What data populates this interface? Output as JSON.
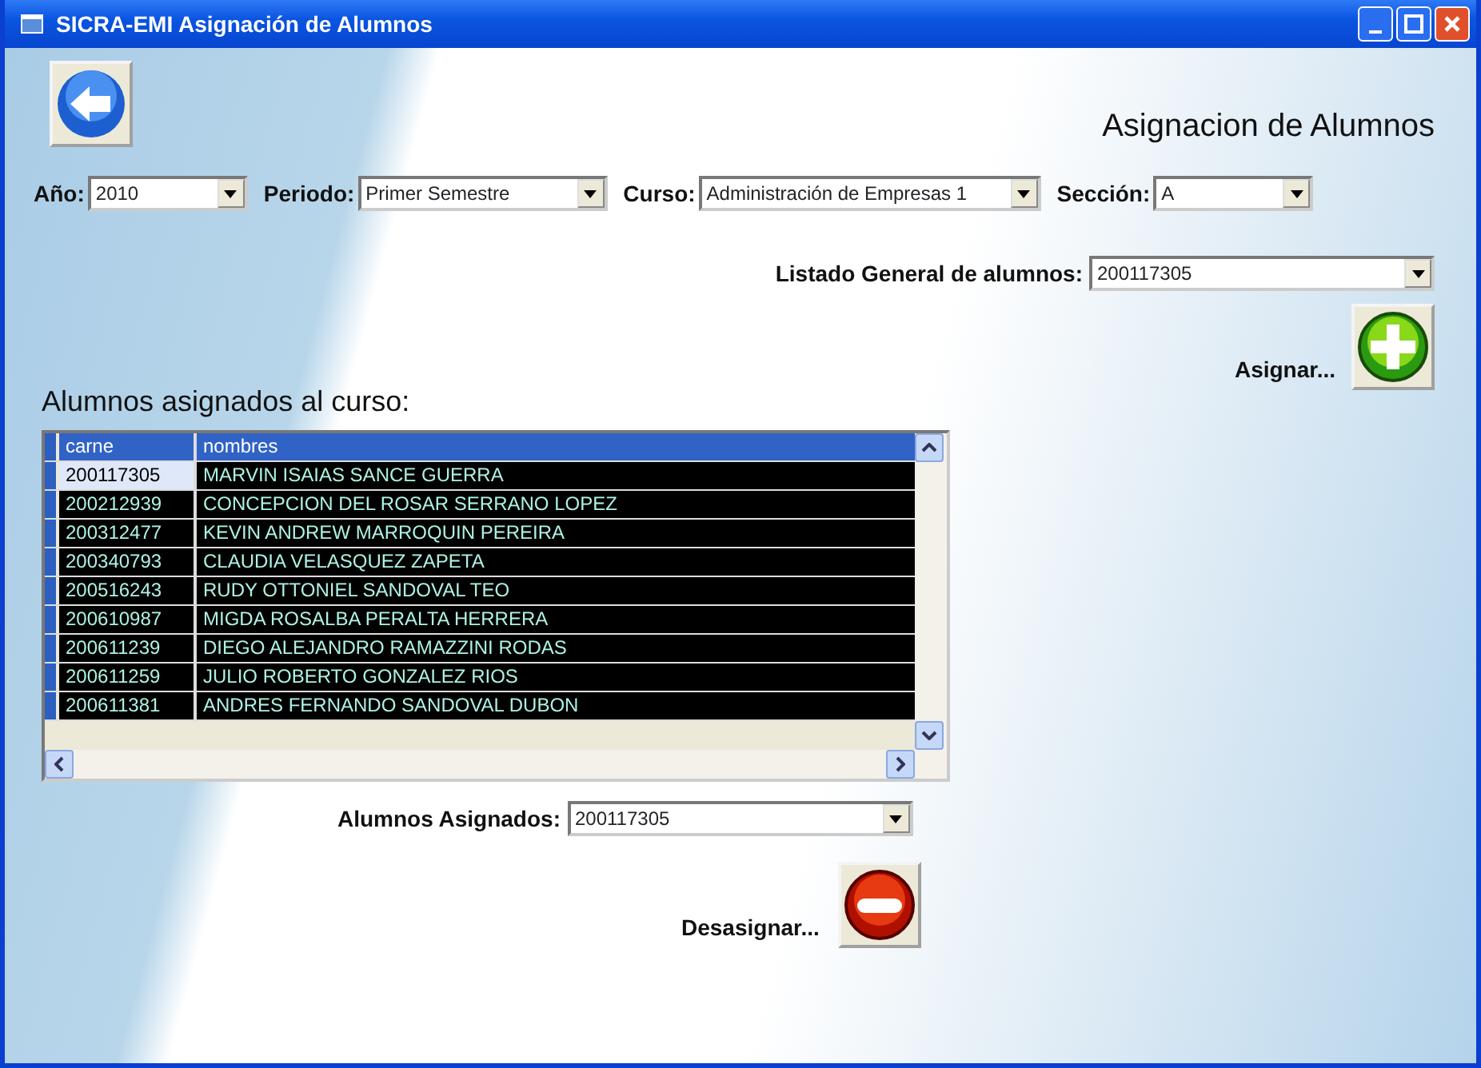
{
  "window": {
    "title": "SICRA-EMI Asignación de Alumnos"
  },
  "heading": "Asignacion de Alumnos",
  "filters": [
    {
      "label": "Año:",
      "value": "2010"
    },
    {
      "label": "Periodo:",
      "value": "Primer Semestre"
    },
    {
      "label": "Curso:",
      "value": "Administración de Empresas 1"
    },
    {
      "label": "Sección:",
      "value": "A"
    }
  ],
  "general_list": {
    "label": "Listado General de alumnos:",
    "value": "200117305"
  },
  "assign": {
    "label": "Asignar..."
  },
  "grid": {
    "title": "Alumnos asignados al curso:",
    "columns": [
      "carne",
      "nombres"
    ],
    "rows": [
      {
        "carne": "200117305",
        "nombres": "MARVIN ISAIAS SANCE GUERRA",
        "selected": true
      },
      {
        "carne": "200212939",
        "nombres": "CONCEPCION DEL ROSAR SERRANO LOPEZ",
        "selected": false
      },
      {
        "carne": "200312477",
        "nombres": "KEVIN ANDREW MARROQUIN PEREIRA",
        "selected": false
      },
      {
        "carne": "200340793",
        "nombres": "CLAUDIA VELASQUEZ ZAPETA",
        "selected": false
      },
      {
        "carne": "200516243",
        "nombres": "RUDY OTTONIEL SANDOVAL TEO",
        "selected": false
      },
      {
        "carne": "200610987",
        "nombres": "MIGDA ROSALBA PERALTA HERRERA",
        "selected": false
      },
      {
        "carne": "200611239",
        "nombres": "DIEGO ALEJANDRO RAMAZZINI RODAS",
        "selected": false
      },
      {
        "carne": "200611259",
        "nombres": "JULIO ROBERTO GONZALEZ RIOS",
        "selected": false
      },
      {
        "carne": "200611381",
        "nombres": "ANDRES FERNANDO SANDOVAL DUBON",
        "selected": false
      }
    ]
  },
  "assigned_list": {
    "label": "Alumnos Asignados:",
    "value": "200117305"
  },
  "unassign": {
    "label": "Desasignar..."
  }
}
